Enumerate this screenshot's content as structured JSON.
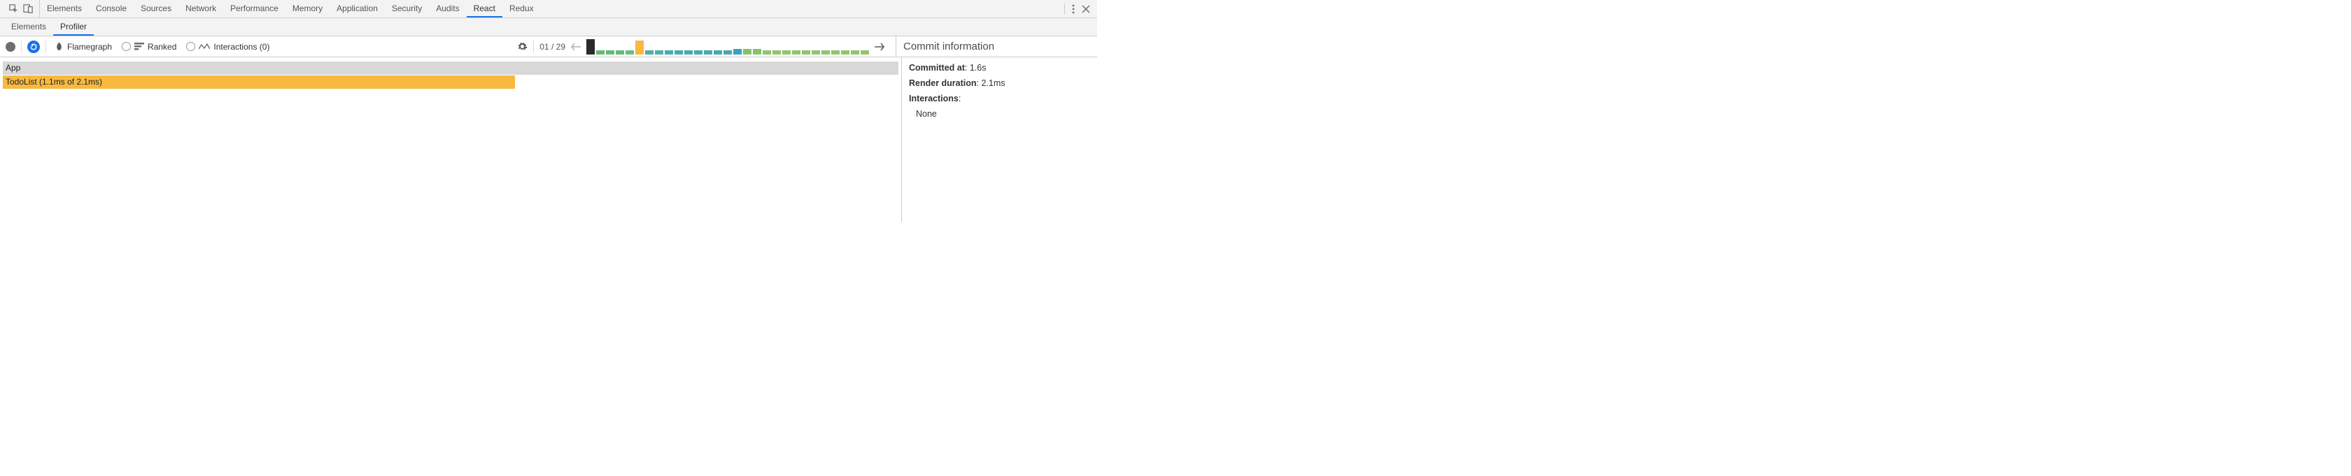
{
  "devtools_tabs": [
    "Elements",
    "Console",
    "Sources",
    "Network",
    "Performance",
    "Memory",
    "Application",
    "Security",
    "Audits",
    "React",
    "Redux"
  ],
  "devtools_active_tab": "React",
  "react_sub_tabs": [
    "Elements",
    "Profiler"
  ],
  "react_sub_active": "Profiler",
  "profiler": {
    "modes": {
      "flamegraph": "Flamegraph",
      "ranked": "Ranked",
      "interactions": "Interactions (0)"
    },
    "commit_index_label": "01 / 29",
    "commit_strip": [
      {
        "h": 22,
        "color": "#2a2a2a"
      },
      {
        "h": 6,
        "color": "#64b97b"
      },
      {
        "h": 6,
        "color": "#64b97b"
      },
      {
        "h": 6,
        "color": "#64b97b"
      },
      {
        "h": 6,
        "color": "#69be7f"
      },
      {
        "h": 20,
        "color": "#f7b940"
      },
      {
        "h": 6,
        "color": "#51b0a1"
      },
      {
        "h": 6,
        "color": "#51b0a1"
      },
      {
        "h": 6,
        "color": "#49aab0"
      },
      {
        "h": 6,
        "color": "#49aab0"
      },
      {
        "h": 6,
        "color": "#49aab0"
      },
      {
        "h": 6,
        "color": "#49aab0"
      },
      {
        "h": 6,
        "color": "#49aab0"
      },
      {
        "h": 6,
        "color": "#49aab0"
      },
      {
        "h": 6,
        "color": "#49aab0"
      },
      {
        "h": 8,
        "color": "#3ba3c2"
      },
      {
        "h": 8,
        "color": "#88c26a"
      },
      {
        "h": 8,
        "color": "#88c26a"
      },
      {
        "h": 6,
        "color": "#8fc66f"
      },
      {
        "h": 6,
        "color": "#8fc66f"
      },
      {
        "h": 6,
        "color": "#8fc66f"
      },
      {
        "h": 6,
        "color": "#8fc66f"
      },
      {
        "h": 6,
        "color": "#8fc66f"
      },
      {
        "h": 6,
        "color": "#8fc66f"
      },
      {
        "h": 6,
        "color": "#8fc66f"
      },
      {
        "h": 6,
        "color": "#8fc66f"
      },
      {
        "h": 6,
        "color": "#8fc66f"
      },
      {
        "h": 6,
        "color": "#8fc66f"
      },
      {
        "h": 6,
        "color": "#8fc66f"
      }
    ]
  },
  "flame": {
    "app_label": "App",
    "todolist_label": "TodoList (1.1ms of 2.1ms)"
  },
  "commit_info": {
    "title": "Commit information",
    "committed_at_label": "Committed at",
    "committed_at_value": "1.6s",
    "render_duration_label": "Render duration",
    "render_duration_value": "2.1ms",
    "interactions_label": "Interactions",
    "interactions_none": "None"
  }
}
